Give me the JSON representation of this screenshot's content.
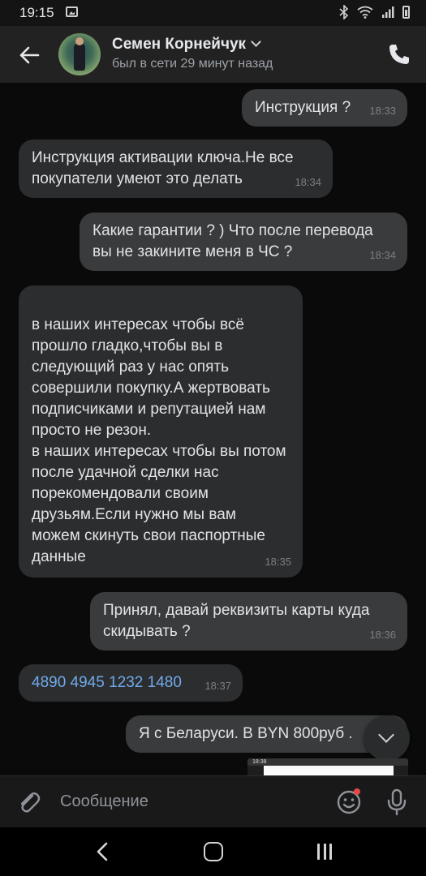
{
  "status_bar": {
    "time": "19:15",
    "icons": [
      "gallery-icon",
      "bluetooth-icon",
      "wifi-icon",
      "signal-icon",
      "battery-icon"
    ]
  },
  "header": {
    "contact_name": "Семен Корнейчук",
    "contact_status": "был в сети 29 минут назад",
    "icons": [
      "back-arrow-icon",
      "chevron-down-icon",
      "phone-icon"
    ]
  },
  "messages": [
    {
      "dir": "out",
      "text": "Инструкция ?",
      "time": "18:33"
    },
    {
      "dir": "in",
      "text": "Инструкция активации ключа.Не все покупатели умеют это делать",
      "time": "18:34"
    },
    {
      "dir": "out",
      "text": "Какие гарантии ? ) Что после перевода вы не закините меня в ЧС ?",
      "time": "18:34"
    },
    {
      "dir": "in",
      "text": "в наших интересах чтобы всё прошло гладко,чтобы вы в следующий раз у нас опять совершили покупку.А жертвовать подписчиками и репутацией нам просто не резон.\nв наших интересах чтобы вы потом после удачной сделки нас порекомендовали своим друзьям.Если нужно мы вам можем скинуть свои паспортные данные",
      "time": "18:35"
    },
    {
      "dir": "out",
      "text": "Принял, давай реквизиты карты куда скидывать ?",
      "time": "18:36"
    },
    {
      "dir": "in",
      "text": "4890 4945 1232 1480",
      "time": "18:37",
      "link": true
    },
    {
      "dir": "out",
      "text": "Я с Беларуси. В BYN 800руб .",
      "time": ""
    }
  ],
  "attachment_preview": {
    "time": "18:38"
  },
  "composer": {
    "placeholder": "Сообщение",
    "icons": [
      "paperclip-icon",
      "emoji-icon",
      "microphone-icon"
    ]
  },
  "nav_bar": {
    "icons": [
      "nav-back-icon",
      "nav-home-icon",
      "nav-recents-icon"
    ]
  },
  "colors": {
    "background": "#0a0a0a",
    "header": "#222222",
    "incoming_bubble": "#2c2d2e",
    "outgoing_bubble": "#3a3b3c",
    "link": "#71aaeb",
    "text": "#e1e3e6",
    "secondary_text": "#9da2a7",
    "notification_dot": "#e64646"
  }
}
